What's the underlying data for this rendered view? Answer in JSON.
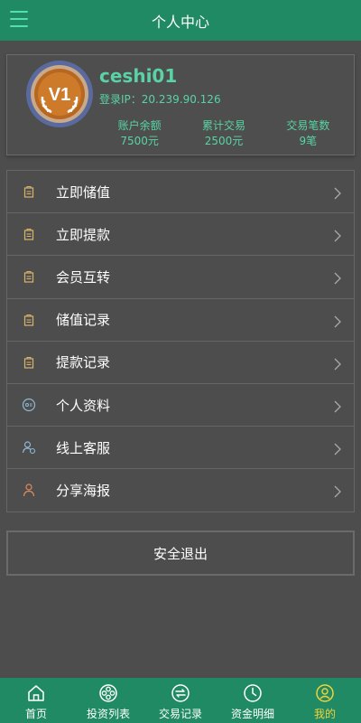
{
  "header": {
    "title": "个人中心",
    "menu_icon": "hamburger-menu-icon"
  },
  "profile": {
    "badge_text": "V1",
    "username": "ceshi01",
    "ip_label": "登录IP：",
    "ip_value": "20.239.90.126",
    "stats": [
      {
        "label": "账户余额",
        "value": "7500元"
      },
      {
        "label": "累计交易",
        "value": "2500元"
      },
      {
        "label": "交易笔数",
        "value": "9笔"
      }
    ]
  },
  "menu": [
    {
      "label": "立即储值",
      "icon": "wallet-icon"
    },
    {
      "label": "立即提款",
      "icon": "wallet-icon"
    },
    {
      "label": "会员互转",
      "icon": "wallet-icon"
    },
    {
      "label": "储值记录",
      "icon": "wallet-icon"
    },
    {
      "label": "提款记录",
      "icon": "wallet-icon"
    },
    {
      "label": "个人资料",
      "icon": "profile-icon"
    },
    {
      "label": "线上客服",
      "icon": "customer-service-icon"
    },
    {
      "label": "分享海报",
      "icon": "share-person-icon"
    }
  ],
  "logout_label": "安全退出",
  "tabs": [
    {
      "label": "首页",
      "icon": "home-icon",
      "active": false
    },
    {
      "label": "投资列表",
      "icon": "film-reel-icon",
      "active": false
    },
    {
      "label": "交易记录",
      "icon": "exchange-icon",
      "active": false
    },
    {
      "label": "资金明细",
      "icon": "clock-icon",
      "active": false
    },
    {
      "label": "我的",
      "icon": "user-icon",
      "active": true
    }
  ],
  "colors": {
    "brand": "#1f8a63",
    "accent_text": "#59d3a5",
    "active_tab": "#f2d23b",
    "background": "#4d4d4d"
  }
}
